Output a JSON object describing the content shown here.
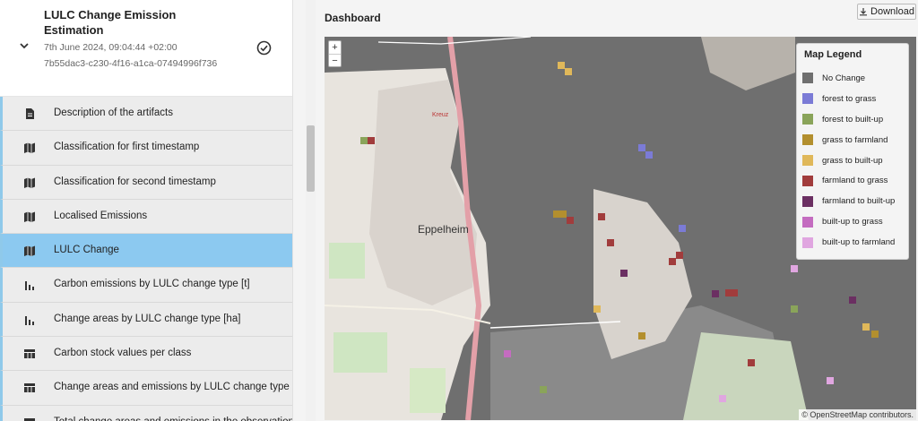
{
  "run": {
    "title": "LULC Change Emission Estimation",
    "timestamp": "7th June 2024, 09:04:44 +02:00",
    "id": "7b55dac3-c230-4f16-a1ca-07494996f736"
  },
  "menu": [
    {
      "label": "Description of the artifacts",
      "icon": "document-icon"
    },
    {
      "label": "Classification for first timestamp",
      "icon": "map-icon"
    },
    {
      "label": "Classification for second timestamp",
      "icon": "map-icon"
    },
    {
      "label": "Localised Emissions",
      "icon": "map-icon"
    },
    {
      "label": "LULC Change",
      "icon": "map-icon",
      "selected": true
    },
    {
      "label": "Carbon emissions by LULC change type [t]",
      "icon": "bar-chart-icon"
    },
    {
      "label": "Change areas by LULC change type [ha]",
      "icon": "bar-chart-icon"
    },
    {
      "label": "Carbon stock values per class",
      "icon": "table-icon"
    },
    {
      "label": "Change areas and emissions by LULC change type",
      "icon": "table-icon"
    },
    {
      "label": "Total change areas and emissions in the observation",
      "icon": "table-icon"
    }
  ],
  "dashboard": {
    "title": "Dashboard",
    "download_label": "Download"
  },
  "map": {
    "zoom_in": "+",
    "zoom_out": "−",
    "place_label": "Eppelheim",
    "road_label": "Kreuz",
    "attribution": "© OpenStreetMap contributors.",
    "legend": {
      "title": "Map Legend",
      "items": [
        {
          "label": "No Change",
          "color": "#6f6f6f"
        },
        {
          "label": "forest to grass",
          "color": "#7b7bd6"
        },
        {
          "label": "forest to built-up",
          "color": "#8aa45a"
        },
        {
          "label": "grass to farmland",
          "color": "#b38f2e"
        },
        {
          "label": "grass to built-up",
          "color": "#e0b85a"
        },
        {
          "label": "farmland to grass",
          "color": "#a13c3c"
        },
        {
          "label": "farmland to built-up",
          "color": "#6b2f62"
        },
        {
          "label": "built-up to grass",
          "color": "#c46cc0"
        },
        {
          "label": "built-up to farmland",
          "color": "#e0a6e0"
        }
      ]
    }
  }
}
